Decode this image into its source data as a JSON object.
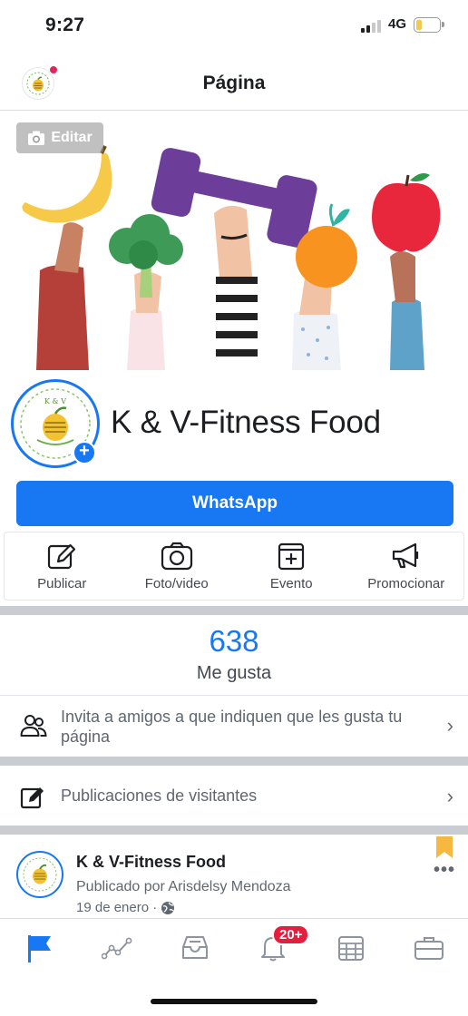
{
  "status_bar": {
    "time": "9:27",
    "network": "4G"
  },
  "header": {
    "title": "Página"
  },
  "cover": {
    "edit_label": "Editar"
  },
  "page": {
    "name": "K & V-Fitness Food"
  },
  "cta": {
    "label": "WhatsApp"
  },
  "actions": [
    {
      "label": "Publicar",
      "icon": "edit-icon"
    },
    {
      "label": "Foto/video",
      "icon": "camera-icon"
    },
    {
      "label": "Evento",
      "icon": "event-icon"
    },
    {
      "label": "Promocionar",
      "icon": "megaphone-icon"
    }
  ],
  "likes": {
    "count": "638",
    "label": "Me gusta"
  },
  "invite": {
    "text": "Invita a amigos a que indiquen que les gusta tu página"
  },
  "visitors": {
    "text": "Publicaciones de visitantes"
  },
  "post": {
    "author": "K & V-Fitness Food",
    "published_by": "Publicado por Arisdelsy Mendoza",
    "date": "19 de enero ·"
  },
  "tabs": [
    {
      "icon": "flag-icon",
      "active": true
    },
    {
      "icon": "insights-icon"
    },
    {
      "icon": "inbox-icon"
    },
    {
      "icon": "notifications-icon",
      "badge": "20+"
    },
    {
      "icon": "calendar-icon"
    },
    {
      "icon": "briefcase-icon"
    }
  ],
  "colors": {
    "accent": "#1877f2",
    "badge": "#e41e3f"
  }
}
